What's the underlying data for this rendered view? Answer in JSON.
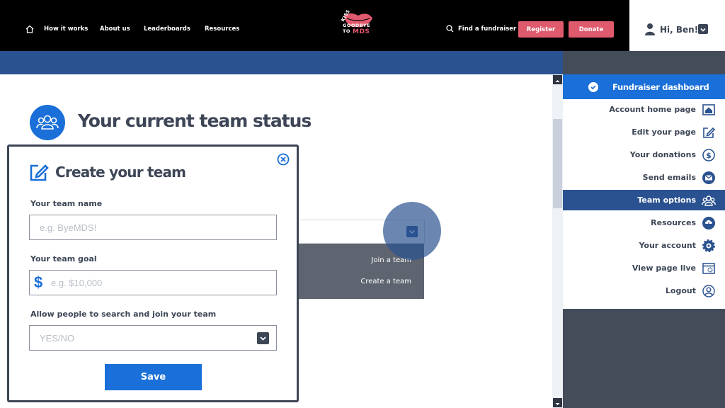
{
  "nav": {
    "links": [
      "How it works",
      "About us",
      "Leaderboards",
      "Resources"
    ],
    "logo_text": [
      "KISS",
      "GOODBYE",
      "TO",
      "MDS"
    ],
    "find_label": "Find a fundraiser",
    "register_label": "Register",
    "donate_label": "Donate",
    "user_greeting": "Hi, Ben!"
  },
  "page": {
    "title": "Your current team status"
  },
  "background_dropdown": {
    "options": [
      "Join a team",
      "Create a team"
    ]
  },
  "modal": {
    "title": "Create your team",
    "team_name_label": "Your team name",
    "team_name_placeholder": "e.g. ByeMDS!",
    "team_goal_label": "Your team goal",
    "team_goal_currency": "$",
    "team_goal_placeholder": "e.g. $10,000",
    "search_label": "Allow people to search and  join your team",
    "search_value": "YES/NO",
    "save_label": "Save"
  },
  "sidebar": {
    "header": "Fundraiser dashboard",
    "items": [
      {
        "label": "Account home page",
        "icon": "home-icon"
      },
      {
        "label": "Edit your page",
        "icon": "edit-icon"
      },
      {
        "label": "Your donations",
        "icon": "dollar-icon"
      },
      {
        "label": "Send emails",
        "icon": "email-icon"
      },
      {
        "label": "Team options",
        "icon": "team-icon",
        "active": true
      },
      {
        "label": "Resources",
        "icon": "cloud-download-icon"
      },
      {
        "label": "Your account",
        "icon": "gear-icon"
      },
      {
        "label": "View page live",
        "icon": "browser-settings-icon"
      },
      {
        "label": "Logout",
        "icon": "user-logout-icon"
      }
    ]
  },
  "colors": {
    "primary_blue": "#1a6fd8",
    "navy": "#2b5290",
    "dark_slate": "#3d4656",
    "pink": "#e05a6d"
  }
}
